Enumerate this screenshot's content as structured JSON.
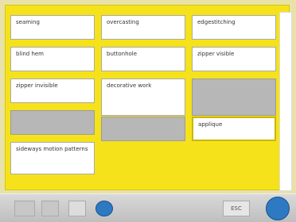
{
  "panel": {
    "tiles": [
      {
        "label": "seaming",
        "state": "normal"
      },
      {
        "label": "overcasting",
        "state": "normal"
      },
      {
        "label": "edgestitching",
        "state": "normal"
      },
      {
        "label": "blind hem",
        "state": "normal"
      },
      {
        "label": "buttonhole",
        "state": "normal"
      },
      {
        "label": "zipper visible",
        "state": "normal"
      },
      {
        "label": "zipper invisible",
        "state": "normal"
      },
      {
        "label": "decorative work",
        "state": "normal"
      },
      {
        "label": "",
        "state": "disabled"
      },
      {
        "label": "",
        "state": "disabled"
      },
      {
        "label": "",
        "state": "disabled"
      },
      {
        "label": "applique",
        "state": "selected"
      },
      {
        "label": "sideways motion patterns",
        "state": "normal"
      }
    ]
  },
  "toolbar": {
    "icons": [
      {
        "name": "machine-icon"
      },
      {
        "name": "gray-icon"
      },
      {
        "name": "home-icon"
      },
      {
        "name": "blue-icon"
      },
      {
        "name": "esc-button"
      },
      {
        "name": "circle-icon"
      }
    ],
    "esc_label": "ESC"
  }
}
